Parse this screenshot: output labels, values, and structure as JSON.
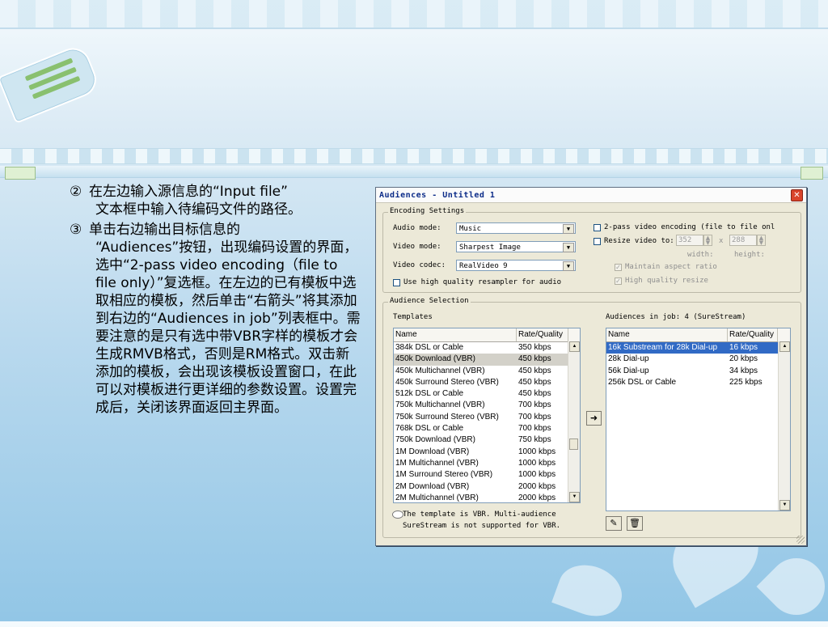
{
  "slide": {
    "items": [
      {
        "number": "②",
        "line1": "在左边输入源信息的“Input file”",
        "line2": "文本框中输入待编码文件的路径。"
      },
      {
        "number": "③",
        "line1": "单击右边输出目标信息的",
        "line2": "“Audiences”按钮，出现编码设置的界面，选中“2-pass video encoding（file to file only）”复选框。在左边的已有模板中选取相应的模板，然后单击“右箭头”将其添加到右边的“Audiences in job”列表框中。需要注意的是只有选中带VBR字样的模板才会生成RMVB格式，否则是RM格式。双击新添加的模板，会出现该模板设置窗口，在此可以对模板进行更详细的参数设置。设置完成后，关闭该界面返回主界面。"
      }
    ]
  },
  "dialog": {
    "title": "Audiences - Untitled 1",
    "close_icon": "close-icon",
    "encoding": {
      "group_label": "Encoding Settings",
      "audio_mode_label": "Audio mode:",
      "audio_mode_value": "Music",
      "video_mode_label": "Video mode:",
      "video_mode_value": "Sharpest Image",
      "video_codec_label": "Video codec:",
      "video_codec_value": "RealVideo 9",
      "high_quality_resampler_label": "Use high quality resampler for audio",
      "high_quality_resampler_checked": false,
      "two_pass_label": "2-pass video encoding (file to file onl",
      "two_pass_checked": false,
      "resize_label": "Resize video to:",
      "resize_checked": false,
      "width_value": "352",
      "x_label": "x",
      "height_value": "288",
      "width_caption": "width:",
      "height_caption": "height:",
      "maintain_aspect_label": "Maintain aspect ratio",
      "maintain_aspect_checked": true,
      "high_quality_resize_label": "High quality resize",
      "high_quality_resize_checked": true
    },
    "audience_selection": {
      "group_label": "Audience Selection",
      "templates_label": "Templates",
      "audiences_label": "Audiences in job: 4  (SureStream)",
      "columns": [
        "Name",
        "Rate/Quality"
      ],
      "templates": [
        {
          "name": "384k DSL or Cable",
          "rate": "350 kbps"
        },
        {
          "name": "450k Download (VBR)",
          "rate": "450 kbps"
        },
        {
          "name": "450k Multichannel (VBR)",
          "rate": "450 kbps"
        },
        {
          "name": "450k Surround Stereo (VBR)",
          "rate": "450 kbps"
        },
        {
          "name": "512k DSL or Cable",
          "rate": "450 kbps"
        },
        {
          "name": "750k Multichannel (VBR)",
          "rate": "700 kbps"
        },
        {
          "name": "750k Surround Stereo (VBR)",
          "rate": "700 kbps"
        },
        {
          "name": "768k DSL or Cable",
          "rate": "700 kbps"
        },
        {
          "name": "750k Download (VBR)",
          "rate": "750 kbps"
        },
        {
          "name": "1M Download (VBR)",
          "rate": "1000 kbps"
        },
        {
          "name": "1M Multichannel (VBR)",
          "rate": "1000 kbps"
        },
        {
          "name": "1M Surround Stereo (VBR)",
          "rate": "1000 kbps"
        },
        {
          "name": "2M Download (VBR)",
          "rate": "2000 kbps"
        },
        {
          "name": "2M Multichannel (VBR)",
          "rate": "2000 kbps"
        }
      ],
      "selected_template": "450k Download (VBR)",
      "audiences": [
        {
          "name": "16k Substream for 28k Dial-up",
          "rate": "16 kbps"
        },
        {
          "name": "28k Dial-up",
          "rate": "20 kbps"
        },
        {
          "name": "56k Dial-up",
          "rate": "34 kbps"
        },
        {
          "name": "256k DSL or Cable",
          "rate": "225 kbps"
        }
      ],
      "selected_audience": "16k Substream for 28k Dial-up",
      "add_button_icon": "right-arrow-icon",
      "note_line1": "The template is VBR. Multi-audience",
      "note_line2": "SureStream is not supported for VBR.",
      "edit_icon": "pencil-icon",
      "delete_icon": "trash-icon"
    }
  },
  "colors": {
    "selection_blue": "#316ac5",
    "dialog_bg": "#ece9d8",
    "title_text": "#0b2b88"
  }
}
